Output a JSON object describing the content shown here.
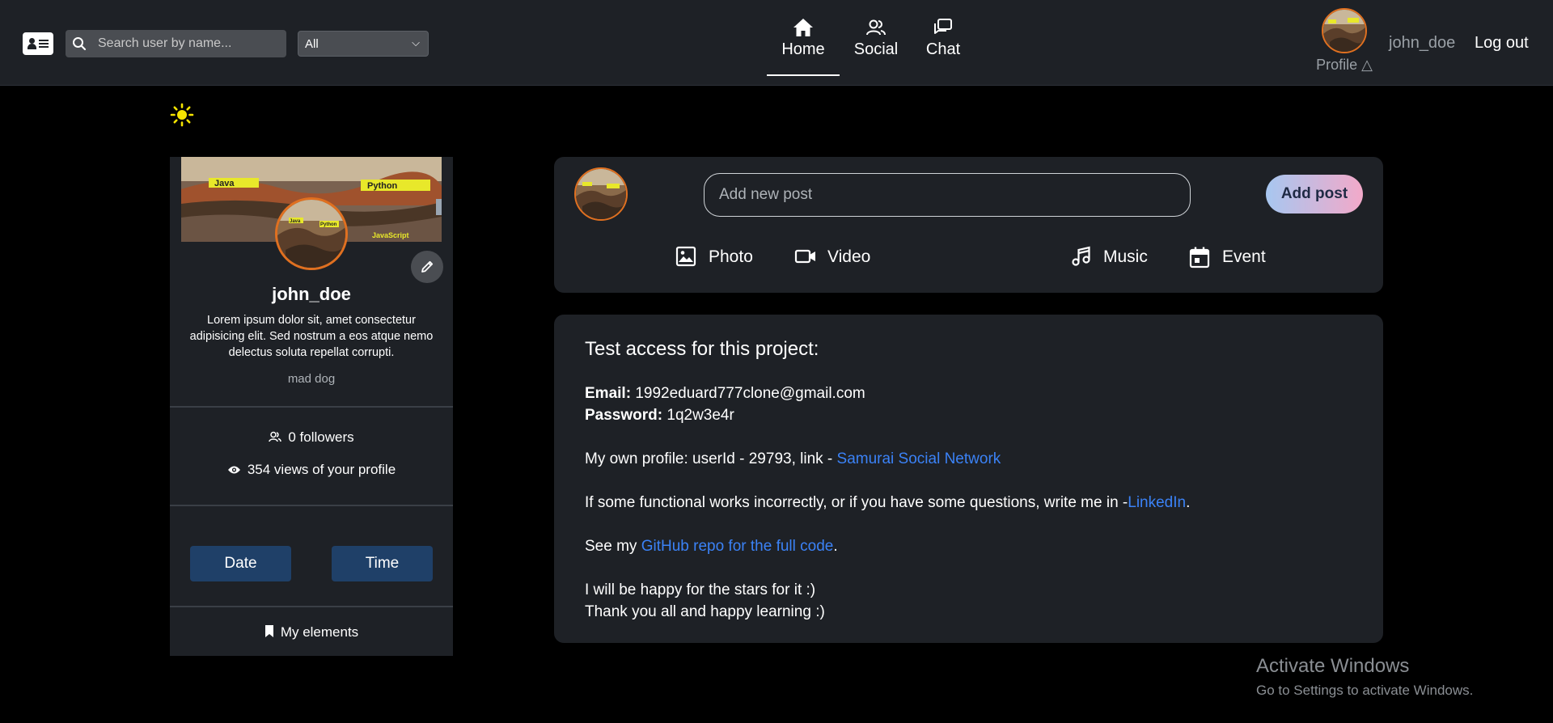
{
  "header": {
    "search_placeholder": "Search user by name...",
    "filter_value": "All",
    "nav": [
      {
        "label": "Home",
        "active": true
      },
      {
        "label": "Social"
      },
      {
        "label": "Chat"
      }
    ],
    "profile_label": "Profile",
    "username": "john_doe",
    "logout_label": "Log out"
  },
  "theme_icon": "sun-icon",
  "profile_card": {
    "cover_texts": [
      "Java",
      "Python",
      "JavaScript"
    ],
    "avatar_texts": [
      "Java",
      "Python"
    ],
    "name": "john_doe",
    "bio": "Lorem ipsum dolor sit, amet consectetur adipisicing elit. Sed nostrum a eos atque nemo delectus soluta repellat corrupti.",
    "status": "mad dog",
    "followers": "0 followers",
    "views": "354 views of your profile",
    "date_button": "Date",
    "time_button": "Time",
    "my_elements": "My elements"
  },
  "composer": {
    "input_placeholder": "Add new post",
    "add_post_label": "Add post",
    "options": [
      {
        "label": "Photo",
        "icon": "image-icon"
      },
      {
        "label": "Video",
        "icon": "video-icon"
      },
      {
        "label": "Music",
        "icon": "music-icon"
      },
      {
        "label": "Event",
        "icon": "calendar-icon"
      }
    ]
  },
  "info": {
    "title": "Test access for this project:",
    "email_label": "Email:",
    "email_value": "1992eduard777clone@gmail.com",
    "password_label": "Password:",
    "password_value": "1q2w3e4r",
    "own_profile_text": "My own profile: userId - 29793, link - ",
    "own_profile_link": "Samurai Social Network",
    "issues_text": "If some functional works incorrectly, or if you have some questions, write me in -",
    "issues_link": "LinkedIn",
    "issues_tail": ".",
    "repo_text": "See my ",
    "repo_link": "GitHub repo for the full code",
    "repo_tail": ".",
    "stars_text": "I will be happy for the stars for it :)",
    "thanks_text": "Thank you all and happy learning :)"
  },
  "watermark": {
    "line1": "Activate Windows",
    "line2": "Go to Settings to activate Windows."
  },
  "colors": {
    "topbar_bg": "#1e2126",
    "card_bg": "#1e2126",
    "page_bg": "#000000",
    "link": "#3b82f6",
    "avatar_ring": "#e07020",
    "button_blue": "#1f4068"
  }
}
